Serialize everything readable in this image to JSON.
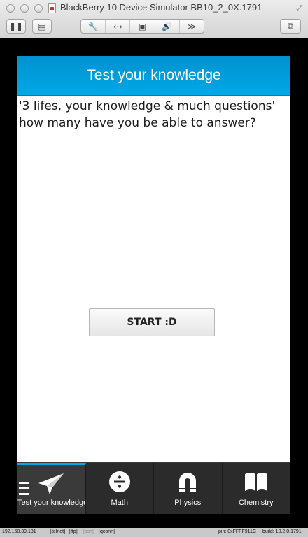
{
  "window": {
    "title": "BlackBerry 10 Device Simulator BB10_2_0X.1791"
  },
  "toolbar": {
    "pause_icon": "pause-icon",
    "screenshot_icon": "screenshot-icon",
    "tools": [
      "wrench-icon",
      "swap-icon",
      "sd-card-icon",
      "speaker-icon",
      "fast-forward-icon"
    ],
    "window_icon": "window-icon"
  },
  "app": {
    "title": "Test your knowledge",
    "question_lines": [
      "'3 lifes,  your knowledge & much questions'",
      " how many have you be able to answer?"
    ],
    "start_button": "START :D",
    "accent_color": "#00a8e6"
  },
  "tabs": [
    {
      "label": "Test your knowledge",
      "icon": "paper-plane-icon",
      "active": true
    },
    {
      "label": "Math",
      "icon": "divide-icon",
      "active": false
    },
    {
      "label": "Physics",
      "icon": "magnet-icon",
      "active": false
    },
    {
      "label": "Chemistry",
      "icon": "book-icon",
      "active": false
    }
  ],
  "status": {
    "ip": "192.168.39.131",
    "telnet": "[telnet]",
    "ftp": "[ftp]",
    "ssh": "[ssh]",
    "qconn": "[qconn]",
    "pin": "pin: 0xFFFF911C",
    "build": "build: 10.2.0.1791"
  }
}
